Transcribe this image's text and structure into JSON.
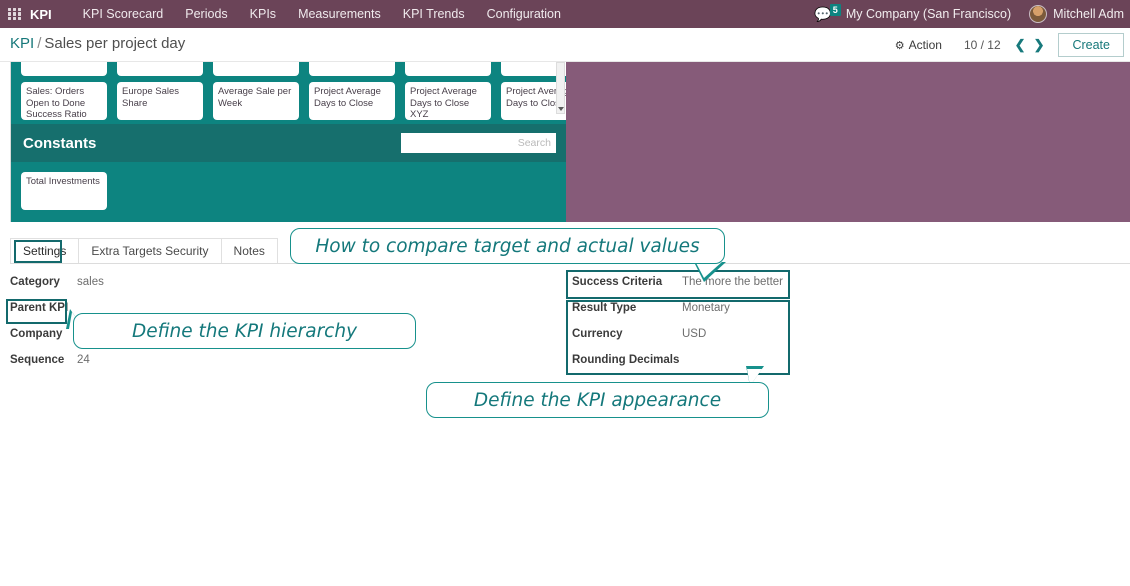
{
  "navbar": {
    "apps_icon": "grid-apps-icon",
    "brand": "KPI",
    "menu": [
      {
        "label": "KPI Scorecard"
      },
      {
        "label": "Periods"
      },
      {
        "label": "KPIs"
      },
      {
        "label": "Measurements"
      },
      {
        "label": "KPI Trends"
      },
      {
        "label": "Configuration"
      }
    ],
    "messages_icon": "chat-bubble-icon",
    "messages_count": "5",
    "company": "My Company (San Francisco)",
    "user": "Mitchell Adm"
  },
  "control_panel": {
    "breadcrumb_root": "KPI",
    "breadcrumb_separator": "/",
    "breadcrumb_current": "Sales per project day",
    "action_label": "Action",
    "action_icon": "gear-icon",
    "pager": "10 / 12",
    "prev_icon": "chevron-left-icon",
    "next_icon": "chevron-right-icon",
    "create_label": "Create"
  },
  "sheet": {
    "tiles_clipped": [
      {
        "label": ""
      },
      {
        "label": ""
      },
      {
        "label": ""
      },
      {
        "label": ""
      },
      {
        "label": ""
      },
      {
        "label": ""
      }
    ],
    "tiles_row1": [
      {
        "label": "Sales: Orders Open to Done Success Ratio"
      },
      {
        "label": "Europe Sales Share"
      },
      {
        "label": "Average Sale per Week"
      },
      {
        "label": "Project Average Days to Close"
      },
      {
        "label": "Project Average Days to Close XYZ"
      },
      {
        "label": "Project Average Days to Close"
      }
    ],
    "band_title": "Constants",
    "search_placeholder": "Search",
    "search_value": "",
    "tiles_row2": [
      {
        "label": "Total Investments"
      }
    ],
    "scrollbar_icon": "scroll-down-caret-icon"
  },
  "notebook": {
    "tabs": [
      {
        "label": "Settings",
        "active": true
      },
      {
        "label": "Extra Targets Security",
        "active": false
      },
      {
        "label": "Notes",
        "active": false
      }
    ]
  },
  "form": {
    "left_fields": [
      {
        "label": "Category",
        "value": "sales"
      },
      {
        "label": "Parent KPI",
        "value": ""
      },
      {
        "label": "Company",
        "value": ""
      },
      {
        "label": "Sequence",
        "value": "24"
      }
    ],
    "right_fields": [
      {
        "label": "Success Criteria",
        "value": "The more the better"
      },
      {
        "label": "Result Type",
        "value": "Monetary"
      },
      {
        "label": "Currency",
        "value": "USD"
      },
      {
        "label": "Rounding Decimals",
        "value": ""
      }
    ]
  },
  "callouts": [
    {
      "text": "How to compare target and actual values"
    },
    {
      "text": "Define the KPI hierarchy"
    },
    {
      "text": "Define the KPI appearance"
    }
  ],
  "colors": {
    "navbar": "#6b4458",
    "teal": "#0d8480",
    "teal_dark": "#166f6d",
    "purple_panel": "#865b79",
    "accent_outline": "#13696c",
    "callout_text": "#14787b",
    "badge": "#0d8480"
  }
}
